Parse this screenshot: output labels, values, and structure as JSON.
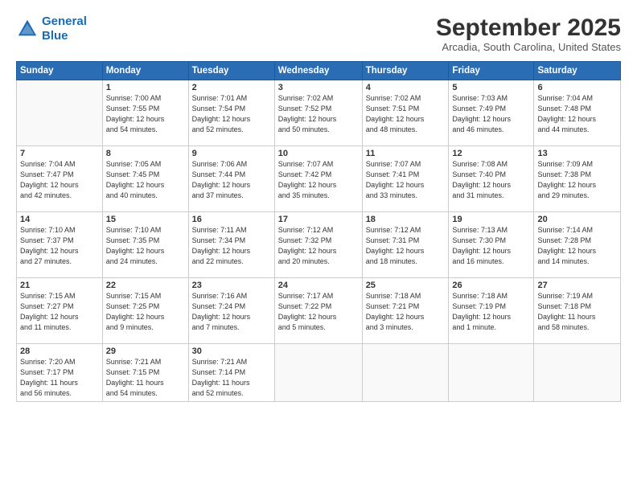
{
  "header": {
    "logo_line1": "General",
    "logo_line2": "Blue",
    "month_title": "September 2025",
    "location": "Arcadia, South Carolina, United States"
  },
  "days_of_week": [
    "Sunday",
    "Monday",
    "Tuesday",
    "Wednesday",
    "Thursday",
    "Friday",
    "Saturday"
  ],
  "weeks": [
    [
      {
        "num": "",
        "info": ""
      },
      {
        "num": "1",
        "info": "Sunrise: 7:00 AM\nSunset: 7:55 PM\nDaylight: 12 hours\nand 54 minutes."
      },
      {
        "num": "2",
        "info": "Sunrise: 7:01 AM\nSunset: 7:54 PM\nDaylight: 12 hours\nand 52 minutes."
      },
      {
        "num": "3",
        "info": "Sunrise: 7:02 AM\nSunset: 7:52 PM\nDaylight: 12 hours\nand 50 minutes."
      },
      {
        "num": "4",
        "info": "Sunrise: 7:02 AM\nSunset: 7:51 PM\nDaylight: 12 hours\nand 48 minutes."
      },
      {
        "num": "5",
        "info": "Sunrise: 7:03 AM\nSunset: 7:49 PM\nDaylight: 12 hours\nand 46 minutes."
      },
      {
        "num": "6",
        "info": "Sunrise: 7:04 AM\nSunset: 7:48 PM\nDaylight: 12 hours\nand 44 minutes."
      }
    ],
    [
      {
        "num": "7",
        "info": "Sunrise: 7:04 AM\nSunset: 7:47 PM\nDaylight: 12 hours\nand 42 minutes."
      },
      {
        "num": "8",
        "info": "Sunrise: 7:05 AM\nSunset: 7:45 PM\nDaylight: 12 hours\nand 40 minutes."
      },
      {
        "num": "9",
        "info": "Sunrise: 7:06 AM\nSunset: 7:44 PM\nDaylight: 12 hours\nand 37 minutes."
      },
      {
        "num": "10",
        "info": "Sunrise: 7:07 AM\nSunset: 7:42 PM\nDaylight: 12 hours\nand 35 minutes."
      },
      {
        "num": "11",
        "info": "Sunrise: 7:07 AM\nSunset: 7:41 PM\nDaylight: 12 hours\nand 33 minutes."
      },
      {
        "num": "12",
        "info": "Sunrise: 7:08 AM\nSunset: 7:40 PM\nDaylight: 12 hours\nand 31 minutes."
      },
      {
        "num": "13",
        "info": "Sunrise: 7:09 AM\nSunset: 7:38 PM\nDaylight: 12 hours\nand 29 minutes."
      }
    ],
    [
      {
        "num": "14",
        "info": "Sunrise: 7:10 AM\nSunset: 7:37 PM\nDaylight: 12 hours\nand 27 minutes."
      },
      {
        "num": "15",
        "info": "Sunrise: 7:10 AM\nSunset: 7:35 PM\nDaylight: 12 hours\nand 24 minutes."
      },
      {
        "num": "16",
        "info": "Sunrise: 7:11 AM\nSunset: 7:34 PM\nDaylight: 12 hours\nand 22 minutes."
      },
      {
        "num": "17",
        "info": "Sunrise: 7:12 AM\nSunset: 7:32 PM\nDaylight: 12 hours\nand 20 minutes."
      },
      {
        "num": "18",
        "info": "Sunrise: 7:12 AM\nSunset: 7:31 PM\nDaylight: 12 hours\nand 18 minutes."
      },
      {
        "num": "19",
        "info": "Sunrise: 7:13 AM\nSunset: 7:30 PM\nDaylight: 12 hours\nand 16 minutes."
      },
      {
        "num": "20",
        "info": "Sunrise: 7:14 AM\nSunset: 7:28 PM\nDaylight: 12 hours\nand 14 minutes."
      }
    ],
    [
      {
        "num": "21",
        "info": "Sunrise: 7:15 AM\nSunset: 7:27 PM\nDaylight: 12 hours\nand 11 minutes."
      },
      {
        "num": "22",
        "info": "Sunrise: 7:15 AM\nSunset: 7:25 PM\nDaylight: 12 hours\nand 9 minutes."
      },
      {
        "num": "23",
        "info": "Sunrise: 7:16 AM\nSunset: 7:24 PM\nDaylight: 12 hours\nand 7 minutes."
      },
      {
        "num": "24",
        "info": "Sunrise: 7:17 AM\nSunset: 7:22 PM\nDaylight: 12 hours\nand 5 minutes."
      },
      {
        "num": "25",
        "info": "Sunrise: 7:18 AM\nSunset: 7:21 PM\nDaylight: 12 hours\nand 3 minutes."
      },
      {
        "num": "26",
        "info": "Sunrise: 7:18 AM\nSunset: 7:19 PM\nDaylight: 12 hours\nand 1 minute."
      },
      {
        "num": "27",
        "info": "Sunrise: 7:19 AM\nSunset: 7:18 PM\nDaylight: 11 hours\nand 58 minutes."
      }
    ],
    [
      {
        "num": "28",
        "info": "Sunrise: 7:20 AM\nSunset: 7:17 PM\nDaylight: 11 hours\nand 56 minutes."
      },
      {
        "num": "29",
        "info": "Sunrise: 7:21 AM\nSunset: 7:15 PM\nDaylight: 11 hours\nand 54 minutes."
      },
      {
        "num": "30",
        "info": "Sunrise: 7:21 AM\nSunset: 7:14 PM\nDaylight: 11 hours\nand 52 minutes."
      },
      {
        "num": "",
        "info": ""
      },
      {
        "num": "",
        "info": ""
      },
      {
        "num": "",
        "info": ""
      },
      {
        "num": "",
        "info": ""
      }
    ]
  ]
}
